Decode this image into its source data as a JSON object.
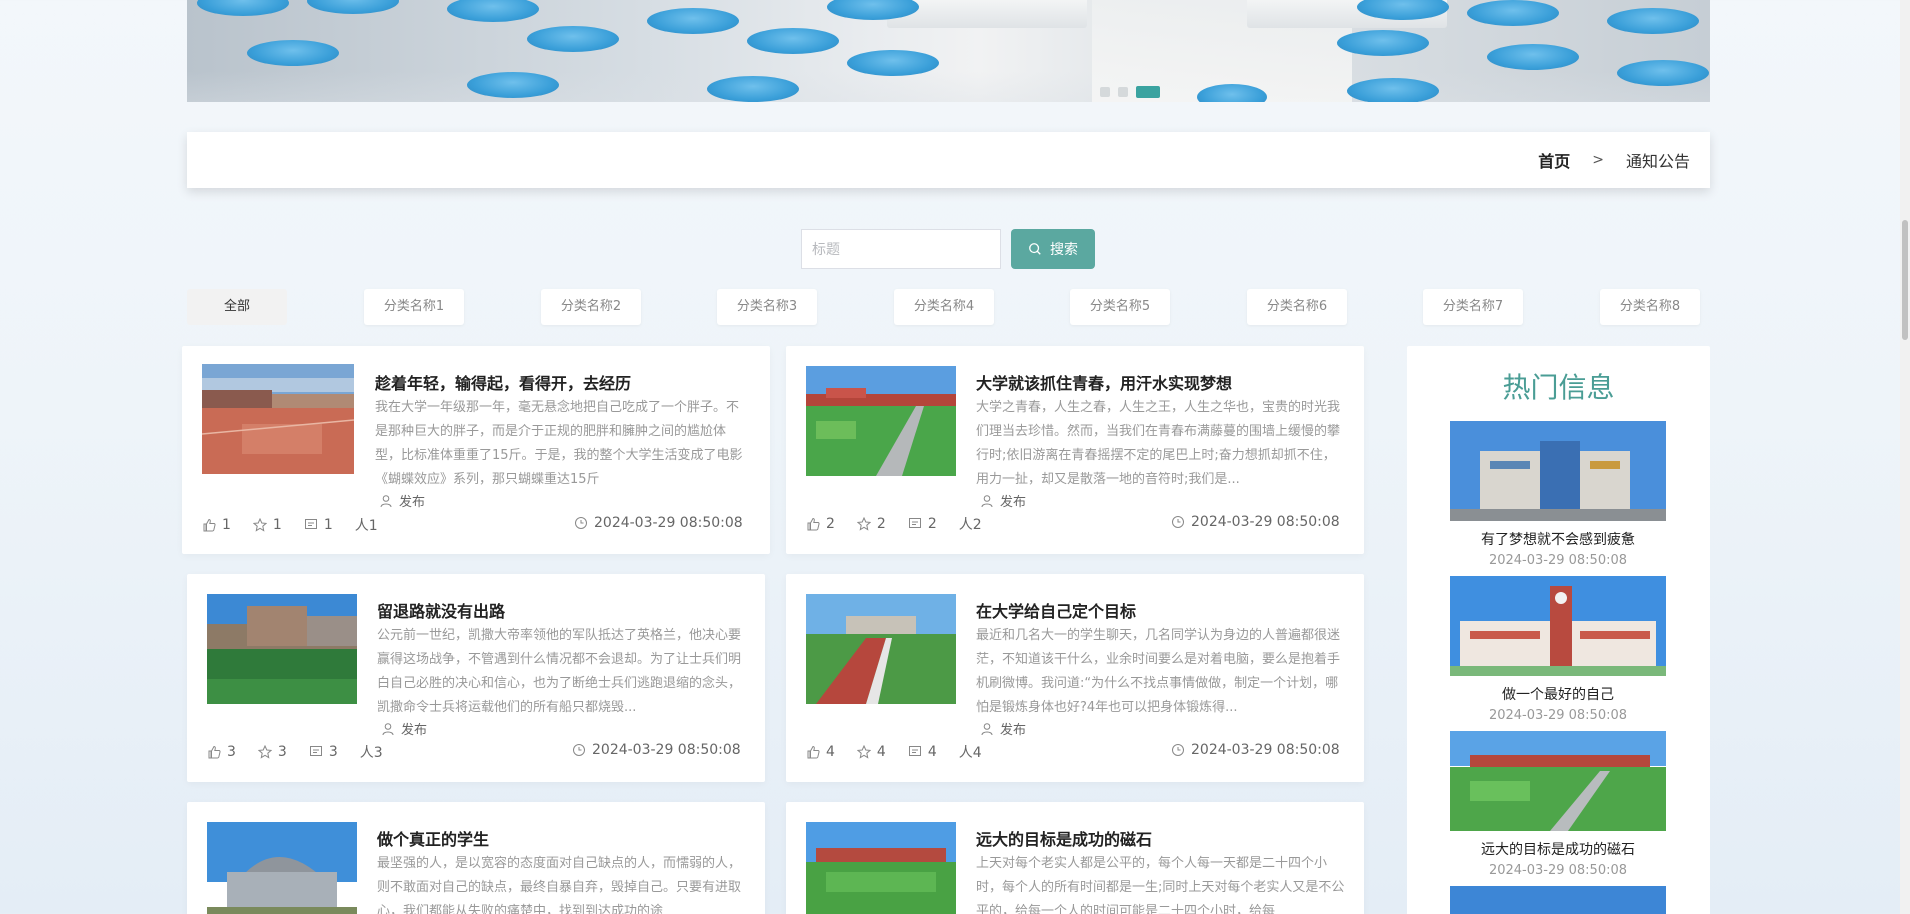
{
  "breadcrumb": {
    "home": "首页",
    "separator": ">",
    "current": "通知公告"
  },
  "search": {
    "placeholder": "标题",
    "button_label": "搜索"
  },
  "tabs": [
    "全部",
    "分类名称1",
    "分类名称2",
    "分类名称3",
    "分类名称4",
    "分类名称5",
    "分类名称6",
    "分类名称7",
    "分类名称8"
  ],
  "articles": [
    {
      "title": "趁着年轻，输得起，看得开，去经历",
      "desc": "我在大学一年级那一年，毫无悬念地把自己吃成了一个胖子。不是那种巨大的胖子，而是介于正规的肥胖和臃肿之间的尴尬体型，比标准体重重了15斤。于是，我的整个大学生活变成了电影《蝴蝶效应》系列，那只蝴蝶重达15斤",
      "author": "发布",
      "likes": "1",
      "stars": "1",
      "comments": "1",
      "person": "人1",
      "time": "2024-03-29 08:50:08"
    },
    {
      "title": "大学就该抓住青春，用汗水实现梦想",
      "desc": "大学之青春，人生之春，人生之王，人生之华也，宝贵的时光我们理当去珍惜。然而，当我们在青春布满藤蔓的围墙上缓慢的攀行时;依旧游离在青春摇摆不定的尾巴上时;奋力想抓却抓不住，用力一扯，却又是散落一地的音符时;我们是...",
      "author": "发布",
      "likes": "2",
      "stars": "2",
      "comments": "2",
      "person": "人2",
      "time": "2024-03-29 08:50:08"
    },
    {
      "title": "留退路就没有出路",
      "desc": "公元前一世纪，凯撒大帝率领他的军队抵达了英格兰，他决心要赢得这场战争，不管遇到什么情况都不会退却。为了让士兵们明白自己必胜的决心和信心，也为了断绝士兵们逃跑退缩的念头，凯撒命令士兵将运载他们的所有船只都烧毁...",
      "author": "发布",
      "likes": "3",
      "stars": "3",
      "comments": "3",
      "person": "人3",
      "time": "2024-03-29 08:50:08"
    },
    {
      "title": "在大学给自己定个目标",
      "desc": "最近和几名大一的学生聊天，几名同学认为身边的人普遍都很迷茫，不知道该干什么，业余时间要么是对着电脑，要么是抱着手机刷微博。我问道:“为什么不找点事情做做，制定一个计划，哪怕是锻炼身体也好?4年也可以把身体锻炼得...",
      "author": "发布",
      "likes": "4",
      "stars": "4",
      "comments": "4",
      "person": "人4",
      "time": "2024-03-29 08:50:08"
    },
    {
      "title": "做个真正的学生",
      "desc": "最坚强的人，是以宽容的态度面对自己缺点的人，而懦弱的人，则不敢面对自己的缺点，最终自暴自弃，毁掉自己。只要有进取心，我们都能从失败的痛楚中，找到到达成功的途",
      "author": "",
      "likes": "",
      "stars": "",
      "comments": "",
      "person": "",
      "time": ""
    },
    {
      "title": "远大的目标是成功的磁石",
      "desc": "上天对每个老实人都是公平的，每个人每一天都是二十四个小时，每个人的所有时间都是一生;同时上天对每个老实人又是不公平的，给每一个人的时间可能是二十四个小时，给每",
      "author": "",
      "likes": "",
      "stars": "",
      "comments": "",
      "person": "",
      "time": ""
    }
  ],
  "hot": {
    "title": "热门信息",
    "items": [
      {
        "name": "有了梦想就不会感到疲惫",
        "time": "2024-03-29 08:50:08"
      },
      {
        "name": "做一个最好的自己",
        "time": "2024-03-29 08:50:08"
      },
      {
        "name": "远大的目标是成功的磁石",
        "time": "2024-03-29 08:50:08"
      }
    ]
  },
  "colors": {
    "accent": "#5ba8a0",
    "hot_title": "#4a9d95",
    "active_dot": "#3aa3a0"
  },
  "icons": {
    "search": "search-icon",
    "like": "thumb-up-icon",
    "star": "star-icon",
    "comment": "comment-icon",
    "user": "user-icon",
    "clock": "clock-icon"
  }
}
